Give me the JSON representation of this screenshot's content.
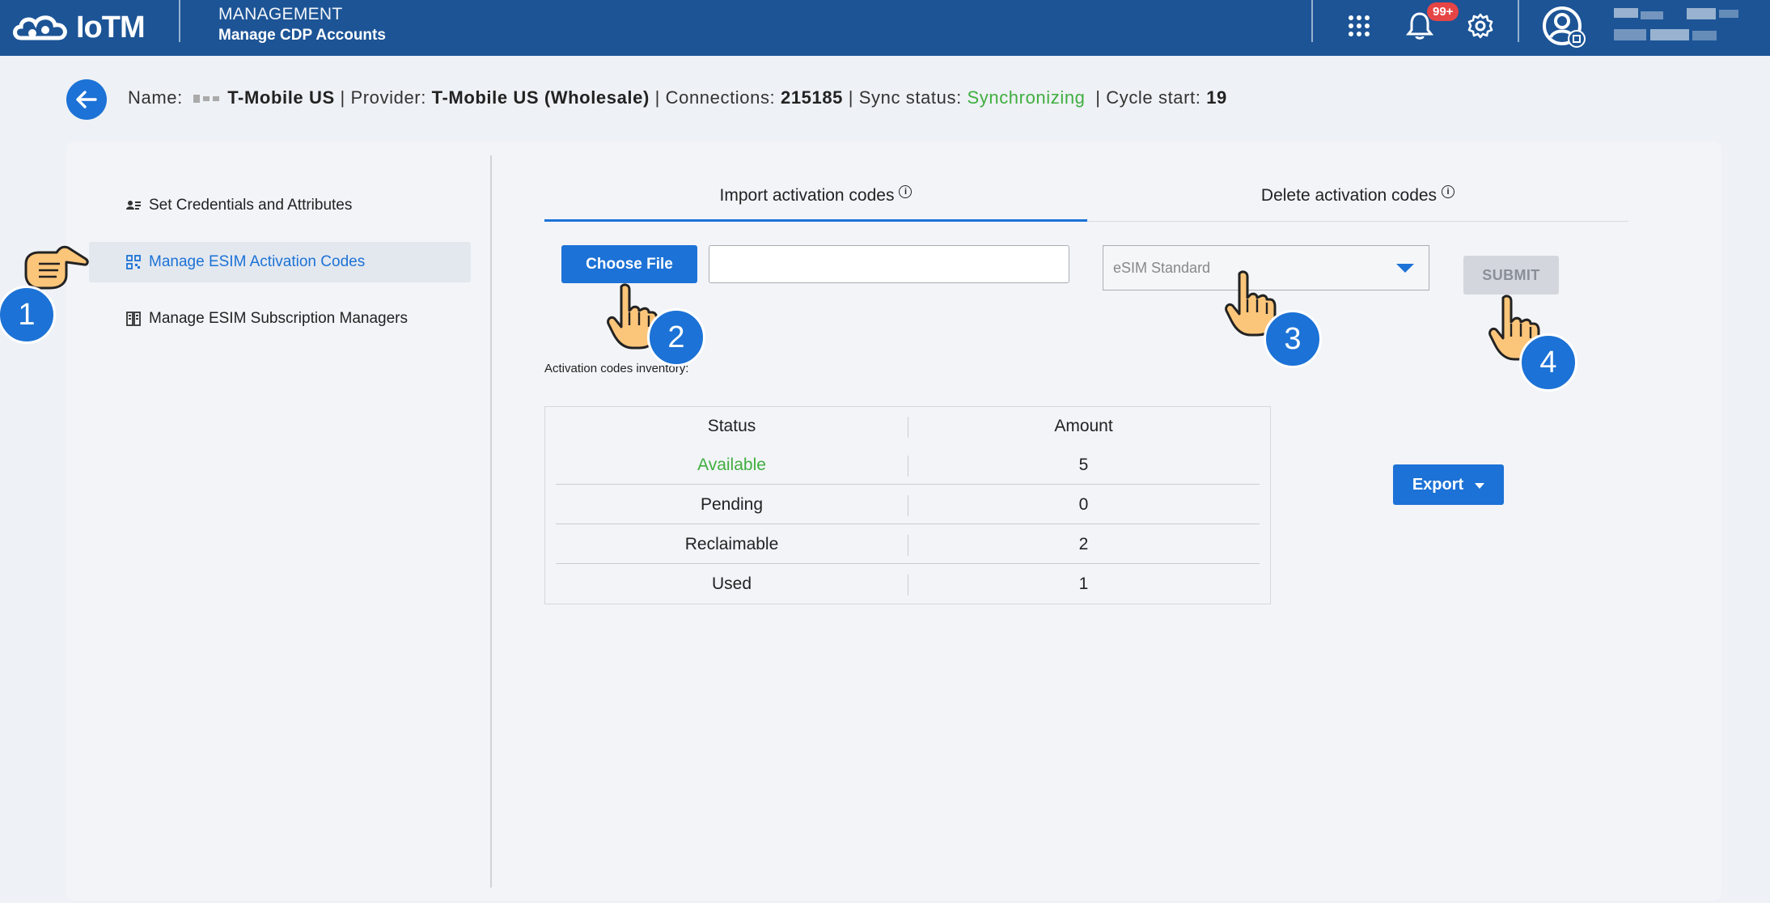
{
  "header": {
    "logo_text": "IoTM",
    "section": "MANAGEMENT",
    "subtitle": "Manage CDP Accounts",
    "notification_count": "99+",
    "icons": [
      "apps-grid-icon",
      "bell-icon",
      "gear-icon",
      "user-avatar-icon"
    ]
  },
  "info": {
    "name_label": "Name:",
    "name_value": "T-Mobile US",
    "provider_label": "| Provider:",
    "provider_value": "T-Mobile US (Wholesale)",
    "connections_label": "| Connections:",
    "connections_value": "215185",
    "sync_label": "| Sync status:",
    "sync_value": "Synchronizing",
    "cycle_label": "| Cycle start:",
    "cycle_value": "19"
  },
  "sidebar": {
    "items": [
      {
        "label": "Set Credentials and Attributes",
        "icon": "credentials-icon"
      },
      {
        "label": "Manage ESIM Activation Codes",
        "icon": "qr-code-icon"
      },
      {
        "label": "Manage ESIM Subscription Managers",
        "icon": "sim-card-icon"
      }
    ]
  },
  "tabs": [
    {
      "label": "Import activation codes"
    },
    {
      "label": "Delete activation codes"
    }
  ],
  "import": {
    "choose_file_label": "Choose File",
    "file_value": "",
    "standard_select": "eSIM Standard",
    "submit_label": "SUBMIT"
  },
  "inventory": {
    "label": "Activation codes inventory:",
    "columns": [
      "Status",
      "Amount"
    ],
    "rows": [
      {
        "status": "Available",
        "amount": "5"
      },
      {
        "status": "Pending",
        "amount": "0"
      },
      {
        "status": "Reclaimable",
        "amount": "2"
      },
      {
        "status": "Used",
        "amount": "1"
      }
    ]
  },
  "export_label": "Export",
  "steps": [
    "1",
    "2",
    "3",
    "4"
  ],
  "colors": {
    "header_bg": "#1c5496",
    "accent": "#1c72d6",
    "success": "#3fae3f",
    "badge": "#e64545"
  }
}
